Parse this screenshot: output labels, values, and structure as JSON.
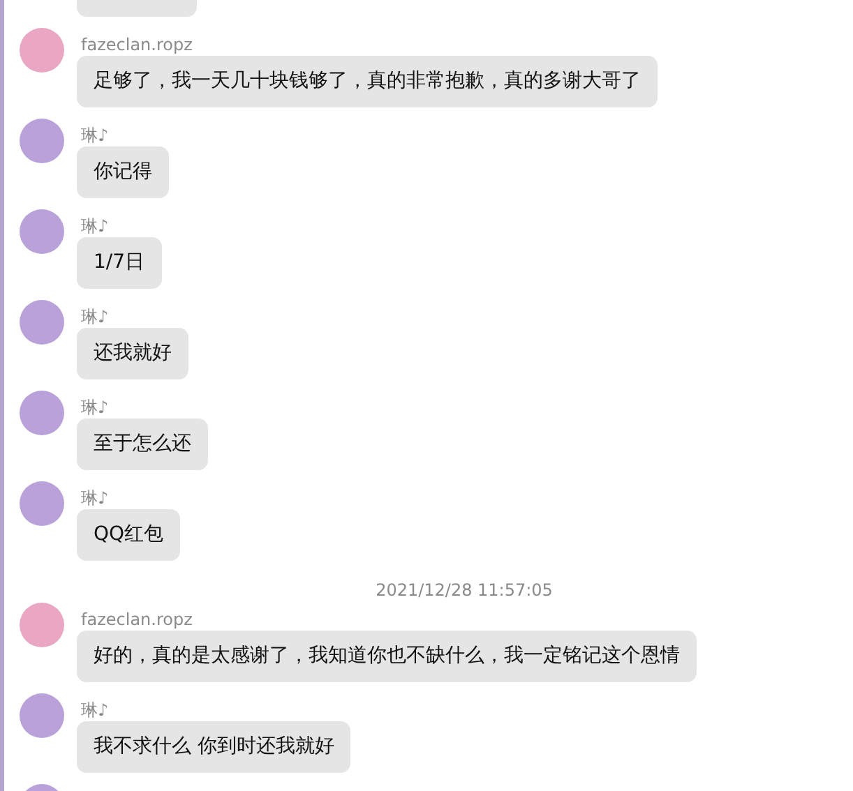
{
  "messages": [
    {
      "kind": "partial_bubble"
    },
    {
      "kind": "message",
      "sender": "fazeclan.ropz",
      "color": "#e9a7c3",
      "text": "足够了，我一天几十块钱够了，真的非常抱歉，真的多谢大哥了"
    },
    {
      "kind": "message",
      "sender": "琳♪",
      "color": "#b9a2d9",
      "text": "你记得"
    },
    {
      "kind": "message",
      "sender": "琳♪",
      "color": "#b9a2d9",
      "text": "1/7日"
    },
    {
      "kind": "message",
      "sender": "琳♪",
      "color": "#b9a2d9",
      "text": "还我就好"
    },
    {
      "kind": "message",
      "sender": "琳♪",
      "color": "#b9a2d9",
      "text": "至于怎么还"
    },
    {
      "kind": "message",
      "sender": "琳♪",
      "color": "#b9a2d9",
      "text": "QQ红包"
    },
    {
      "kind": "timestamp",
      "text": "2021/12/28 11:57:05"
    },
    {
      "kind": "message",
      "sender": "fazeclan.ropz",
      "color": "#e9a7c3",
      "text": "好的，真的是太感谢了，我知道你也不缺什么，我一定铭记这个恩情"
    },
    {
      "kind": "message",
      "sender": "琳♪",
      "color": "#b9a2d9",
      "text": "我不求什么 你到时还我就好"
    },
    {
      "kind": "partial_message",
      "color": "#b9a2d9"
    }
  ]
}
